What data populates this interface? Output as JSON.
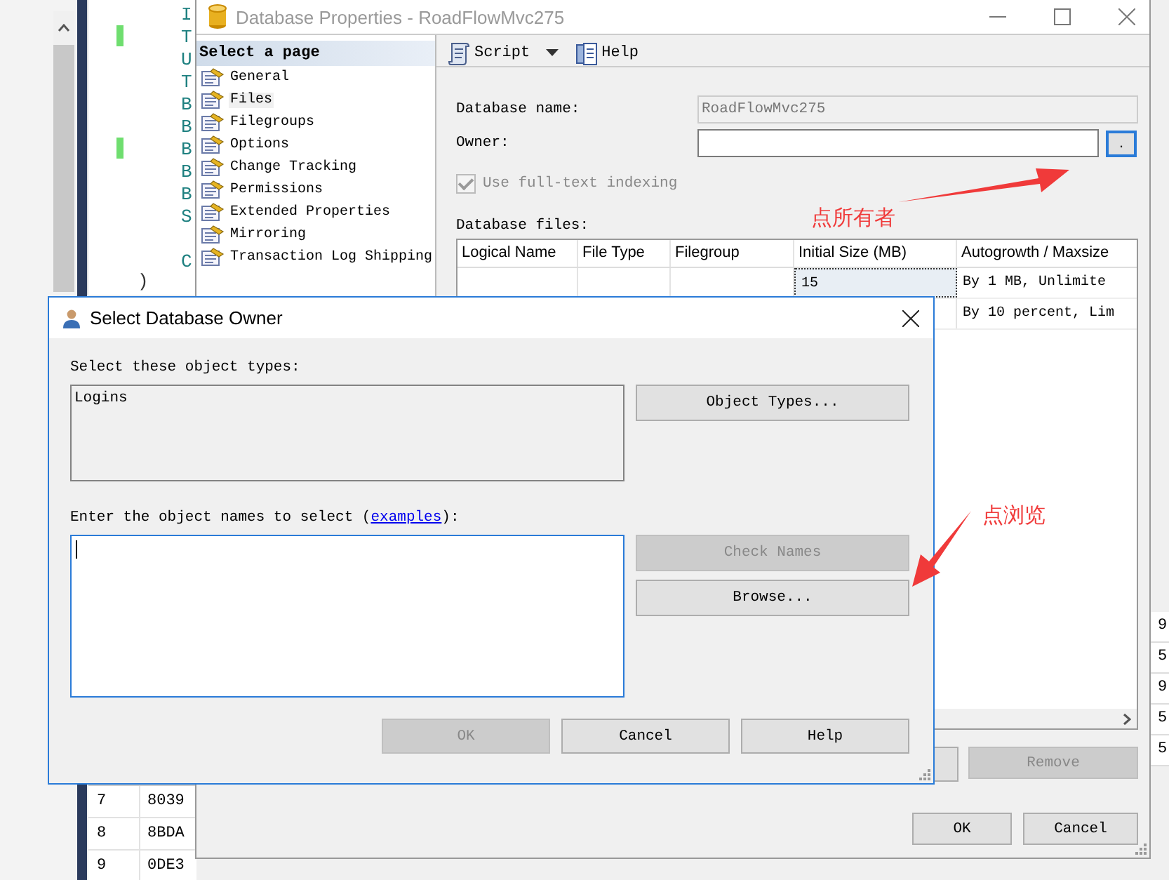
{
  "editor": {
    "code_blocks": [
      [
        "I",
        "T",
        "U",
        "T",
        "B",
        "B",
        "B",
        "B",
        "B",
        "S"
      ],
      [
        "C"
      ]
    ],
    "closing": ")"
  },
  "results_grid": {
    "rows": [
      {
        "number": "7",
        "id": "8039"
      },
      {
        "number": "8",
        "id": "8BDA"
      },
      {
        "number": "9",
        "id": "0DE3"
      }
    ],
    "edge_cells": [
      "9",
      "5",
      "9",
      "5",
      "5"
    ]
  },
  "properties_window": {
    "title": "Database Properties - RoadFlowMvc275",
    "page_header": "Select a page",
    "pages": [
      {
        "label": "General",
        "selected": false
      },
      {
        "label": "Files",
        "selected": true
      },
      {
        "label": "Filegroups",
        "selected": false
      },
      {
        "label": "Options",
        "selected": false
      },
      {
        "label": "Change Tracking",
        "selected": false
      },
      {
        "label": "Permissions",
        "selected": false
      },
      {
        "label": "Extended Properties",
        "selected": false
      },
      {
        "label": "Mirroring",
        "selected": false
      },
      {
        "label": "Transaction Log Shipping",
        "selected": false
      }
    ],
    "toolbar": [
      {
        "label": "Script",
        "kind": "dropdown"
      },
      {
        "label": "Help",
        "kind": "button"
      }
    ],
    "database_name": {
      "label": "Database name:",
      "value": "RoadFlowMvc275",
      "disabled": true
    },
    "owner": {
      "label": "Owner:",
      "button": "."
    },
    "fulltext": {
      "label": "Use full-text indexing",
      "checked": true,
      "disabled": true
    },
    "files_label": "Database files:",
    "files_table": {
      "columns": [
        "Logical Name",
        "File Type",
        "Filegroup",
        "Initial Size (MB)",
        "Autogrowth / Maxsize"
      ],
      "rows": [
        {
          "initial_size": "15",
          "autogrowth": "By 1 MB, Unlimite",
          "focused": true
        },
        {
          "autogrowth": "By 10 percent, Lim",
          "focused": false
        }
      ]
    },
    "table_buttons": [
      {
        "label": "Remove",
        "disabled": true
      }
    ],
    "buttons": [
      {
        "label": "OK"
      },
      {
        "label": "Cancel"
      }
    ]
  },
  "owner_dialog": {
    "title": "Select Database Owner",
    "types_label": "Select these object types:",
    "object_types": [
      "Logins"
    ],
    "object_types_button": "Object Types...",
    "names_prompt": {
      "before": "Enter the object names to select (",
      "link": "examples",
      "after": "):"
    },
    "side_buttons": [
      {
        "label": "Check Names",
        "disabled": true
      },
      {
        "label": "Browse...",
        "disabled": false
      }
    ],
    "buttons": [
      {
        "label": "OK",
        "disabled": true
      },
      {
        "label": "Cancel",
        "disabled": false
      },
      {
        "label": "Help",
        "disabled": false
      }
    ]
  },
  "annotations": [
    {
      "text": "点所有者"
    },
    {
      "text": "点浏览"
    }
  ]
}
